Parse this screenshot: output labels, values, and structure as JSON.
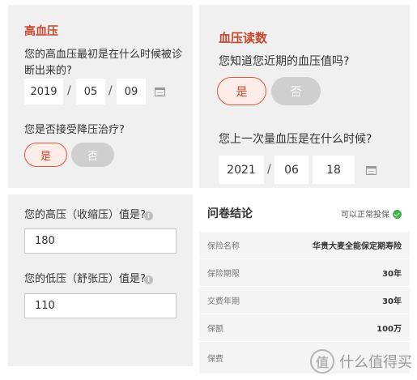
{
  "hbp": {
    "title": "高血压",
    "question1": "您的高血压最初是在什么时候被诊断出来的?",
    "date": {
      "year": "2019",
      "month": "05",
      "day": "09"
    },
    "question2": "您是否接受降压治疗?",
    "yes": "是",
    "no": "否"
  },
  "bp_reading": {
    "title": "血压读数",
    "question1": "您知道您近期的血压值吗?",
    "yes": "是",
    "no": "否",
    "question2": "您上一次量血压是在什么时候?",
    "date": {
      "year": "2021",
      "month": "06",
      "day": "18"
    }
  },
  "values": {
    "systolic_label": "您的高压（收缩压）值是?",
    "systolic_value": "180",
    "diastolic_label": "您的低压（舒张压）值是?",
    "diastolic_value": "110"
  },
  "conclusion": {
    "title": "问卷结论",
    "status": "可以正常投保",
    "rows": [
      {
        "key": "保险名称",
        "value": "华贵大麦全能保定期寿险"
      },
      {
        "key": "保险期限",
        "value": "30年"
      },
      {
        "key": "交费年期",
        "value": "30年"
      },
      {
        "key": "保额",
        "value": "100万"
      },
      {
        "key": "保费",
        "value": ""
      }
    ]
  },
  "watermark": {
    "logo_glyph": "值",
    "text": "什么值得买"
  },
  "colors": {
    "accent": "#c9452b",
    "panel_bg": "#f0f0f0",
    "success": "#3cb34a"
  }
}
